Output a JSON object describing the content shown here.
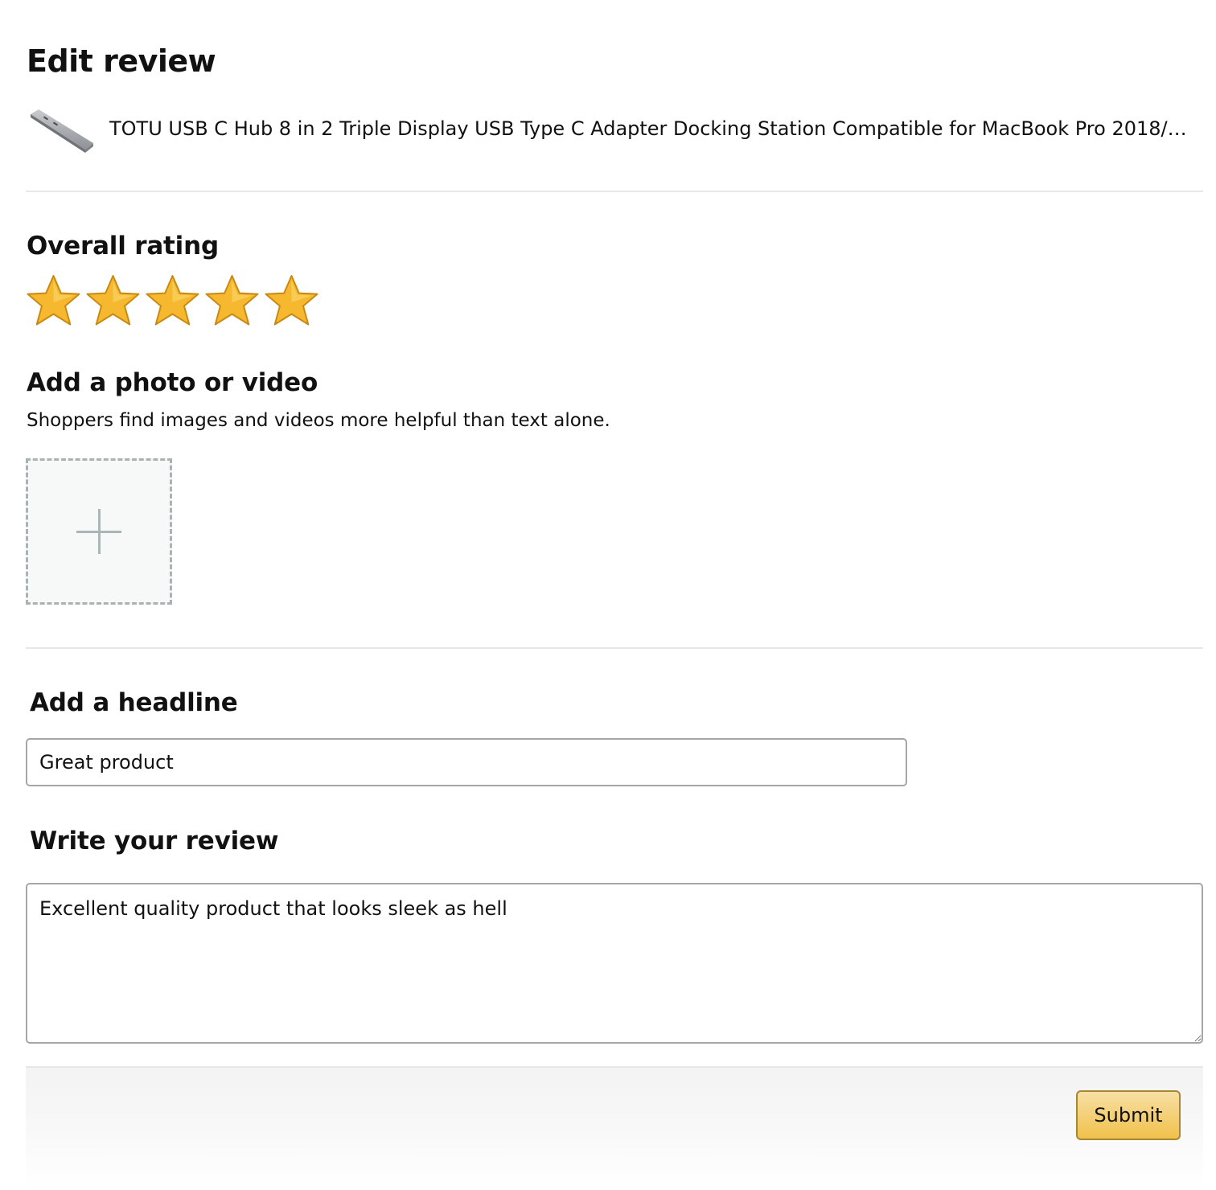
{
  "page": {
    "title": "Edit review"
  },
  "product": {
    "name": "TOTU USB C Hub 8 in 2 Triple Display USB Type C Adapter Docking Station Compatible for MacBook Pro 2018/…",
    "thumbnail_icon": "usb-c-hub-thumbnail"
  },
  "rating": {
    "heading": "Overall rating",
    "value": 5,
    "max": 5,
    "star_color": "#f5b82e"
  },
  "media": {
    "heading": "Add a photo or video",
    "subtitle": "Shoppers find images and videos more helpful than text alone.",
    "upload_icon": "plus-icon"
  },
  "headline": {
    "heading": "Add a headline",
    "value": "Great product"
  },
  "review": {
    "heading": "Write your review",
    "value": "Excellent quality product that looks sleek as hell"
  },
  "footer": {
    "submit_label": "Submit",
    "submit_color": "#f0c14b"
  }
}
